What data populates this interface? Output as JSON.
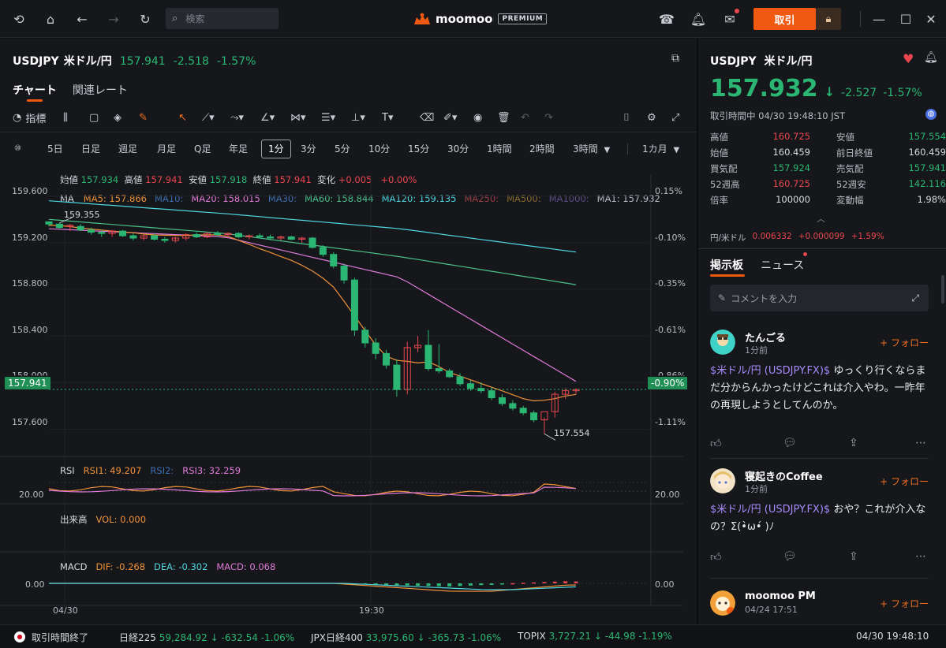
{
  "search": {
    "placeholder": "検索"
  },
  "logo": {
    "name": "moomoo",
    "badge": "PREMIUM"
  },
  "topbar": {
    "trade_label": "取引"
  },
  "instrument": {
    "code": "USDJPY",
    "name": "米ドル/円",
    "price": "157.941",
    "change": "-2.518",
    "change_pct": "-1.57%"
  },
  "left_tabs": [
    "チャート",
    "関連レート"
  ],
  "tools": {
    "indicators_label": "指標"
  },
  "intervals": [
    "5日",
    "日足",
    "週足",
    "月足",
    "Q足",
    "年足",
    "1分",
    "3分",
    "5分",
    "10分",
    "15分",
    "30分",
    "1時間",
    "2時間",
    "3時間",
    "1カ月"
  ],
  "ohlc": {
    "open_label": "始値",
    "open": "157.934",
    "high_label": "高値",
    "high": "157.941",
    "low_label": "安値",
    "low": "157.918",
    "close_label": "終値",
    "close": "157.941",
    "chg_label": "変化",
    "chg": "+0.005",
    "chg_pct": "+0.00%"
  },
  "ma_legend": {
    "label": "MA",
    "items": [
      {
        "text": "MA5: 157.866",
        "color": "#f0923a"
      },
      {
        "text": "MA10:",
        "color": "#3c6fb0"
      },
      {
        "text": "MA20: 158.015",
        "color": "#e07ad8"
      },
      {
        "text": "MA30:",
        "color": "#3c6fb0"
      },
      {
        "text": "MA60: 158.844",
        "color": "#4bc08a"
      },
      {
        "text": "MA120: 159.135",
        "color": "#4fd6e0"
      },
      {
        "text": "MA250:",
        "color": "#9c3f48"
      },
      {
        "text": "MA500:",
        "color": "#8a6a2f"
      },
      {
        "text": "MA1000:",
        "color": "#5c4f86"
      },
      {
        "text": "MA1: 157.932",
        "color": "#b9bcc2"
      }
    ]
  },
  "price_axis": [
    "159.600",
    "159.200",
    "158.800",
    "158.400",
    "158.000",
    "157.600"
  ],
  "pct_axis": [
    "0.15%",
    "-0.10%",
    "-0.35%",
    "-0.61%",
    "-0.86%",
    "-1.11%"
  ],
  "current_price_tag": "157.941",
  "current_pct_tag": "-0.90%",
  "high_marker": "159.355",
  "low_marker": "157.554",
  "rsi": {
    "label": "RSI",
    "rsi1": "RSI1: 49.207",
    "rsi2": "RSI2:",
    "rsi3": "RSI3: 32.259",
    "level": "20.00"
  },
  "volume": {
    "label": "出来高",
    "vol": "VOL: 0.000"
  },
  "macd": {
    "label": "MACD",
    "dif": "DIF: -0.268",
    "dea": "DEA: -0.302",
    "macd": "MACD: 0.068",
    "zero": "0.00"
  },
  "time_axis": [
    "04/30",
    "19:30"
  ],
  "chart_data": {
    "type": "candlestick",
    "title": "USDJPY 米ドル/円",
    "ylim": [
      157.4,
      159.7
    ],
    "candles": [
      [
        159.38,
        159.38,
        159.34,
        159.36
      ],
      [
        159.36,
        159.37,
        159.32,
        159.33
      ],
      [
        159.34,
        159.36,
        159.3,
        159.35
      ],
      [
        159.34,
        159.36,
        159.3,
        159.31
      ],
      [
        159.31,
        159.33,
        159.27,
        159.29
      ],
      [
        159.29,
        159.31,
        159.25,
        159.28
      ],
      [
        159.28,
        159.31,
        159.25,
        159.3
      ],
      [
        159.3,
        159.31,
        159.25,
        159.26
      ],
      [
        159.26,
        159.28,
        159.22,
        159.24
      ],
      [
        159.24,
        159.27,
        159.22,
        159.26
      ],
      [
        159.26,
        159.28,
        159.22,
        159.23
      ],
      [
        159.23,
        159.25,
        159.2,
        159.22
      ],
      [
        159.22,
        159.25,
        159.2,
        159.24
      ],
      [
        159.24,
        159.28,
        159.22,
        159.27
      ],
      [
        159.27,
        159.29,
        159.24,
        159.25
      ],
      [
        159.25,
        159.29,
        159.24,
        159.28
      ],
      [
        159.28,
        159.3,
        159.25,
        159.27
      ],
      [
        159.27,
        159.29,
        159.25,
        159.28
      ],
      [
        159.28,
        159.29,
        159.24,
        159.25
      ],
      [
        159.25,
        159.27,
        159.23,
        159.26
      ],
      [
        159.26,
        159.28,
        159.24,
        159.25
      ],
      [
        159.25,
        159.27,
        159.22,
        159.24
      ],
      [
        159.24,
        159.26,
        159.22,
        159.25
      ],
      [
        159.25,
        159.26,
        159.22,
        159.23
      ],
      [
        159.23,
        159.25,
        159.2,
        159.24
      ],
      [
        159.24,
        159.25,
        159.15,
        159.16
      ],
      [
        159.16,
        159.18,
        159.08,
        159.1
      ],
      [
        159.1,
        159.12,
        158.98,
        159.0
      ],
      [
        159.0,
        159.02,
        158.85,
        158.88
      ],
      [
        158.88,
        158.9,
        158.4,
        158.45
      ],
      [
        158.45,
        158.48,
        158.3,
        158.34
      ],
      [
        158.34,
        158.38,
        158.2,
        158.25
      ],
      [
        158.25,
        158.28,
        158.12,
        158.15
      ],
      [
        158.15,
        158.2,
        157.88,
        157.94
      ],
      [
        157.94,
        158.35,
        157.9,
        158.3
      ],
      [
        158.3,
        158.4,
        158.26,
        158.32
      ],
      [
        158.32,
        158.45,
        158.1,
        158.12
      ],
      [
        158.12,
        158.33,
        158.08,
        158.1
      ],
      [
        158.1,
        158.12,
        158.04,
        158.05
      ],
      [
        158.05,
        158.08,
        157.97,
        157.99
      ],
      [
        157.99,
        158.02,
        157.93,
        157.95
      ],
      [
        157.95,
        158.0,
        157.91,
        157.93
      ],
      [
        157.93,
        157.96,
        157.85,
        157.87
      ],
      [
        157.87,
        157.9,
        157.8,
        157.82
      ],
      [
        157.82,
        157.85,
        157.76,
        157.78
      ],
      [
        157.78,
        157.8,
        157.72,
        157.74
      ],
      [
        157.74,
        157.76,
        157.66,
        157.68
      ],
      [
        157.68,
        157.7,
        157.56,
        157.75
      ],
      [
        157.75,
        157.92,
        157.7,
        157.9
      ],
      [
        157.9,
        157.95,
        157.86,
        157.93
      ],
      [
        157.93,
        157.95,
        157.9,
        157.94
      ]
    ],
    "series": [
      {
        "name": "MA120",
        "values": [
          159.56,
          159.45,
          159.32,
          159.12
        ]
      },
      {
        "name": "MA60",
        "values": [
          159.4,
          159.28,
          159.08,
          158.84
        ]
      },
      {
        "name": "MA20",
        "values": [
          159.32,
          159.25,
          158.9,
          158.01
        ]
      },
      {
        "name": "MA5",
        "values": [
          159.35,
          159.26,
          158.2,
          157.87
        ]
      }
    ]
  },
  "right": {
    "code": "USDJPY",
    "name": "米ドル/円",
    "price": "157.932",
    "change": "-2.527",
    "change_pct": "-1.57%",
    "status": "取引時間中 04/30 19:48:10 JST",
    "stats": [
      {
        "k": "高値",
        "v": "160.725",
        "c": "red"
      },
      {
        "k": "安値",
        "v": "157.554",
        "c": "green"
      },
      {
        "k": "始値",
        "v": "160.459",
        "c": "plain"
      },
      {
        "k": "前日終値",
        "v": "160.459",
        "c": "plain"
      },
      {
        "k": "買気配",
        "v": "157.924",
        "c": "green"
      },
      {
        "k": "売気配",
        "v": "157.941",
        "c": "green"
      },
      {
        "k": "52週高",
        "v": "160.725",
        "c": "red"
      },
      {
        "k": "52週安",
        "v": "142.116",
        "c": "green"
      },
      {
        "k": "倍率",
        "v": "100000",
        "c": "plain"
      },
      {
        "k": "変動幅",
        "v": "1.98%",
        "c": "plain"
      }
    ],
    "fx": {
      "label": "円/米ドル",
      "value": "0.006332",
      "change": "+0.000099",
      "pct": "+1.59%"
    },
    "tabs": [
      "掲示板",
      "ニュース"
    ],
    "comment_placeholder": "コメントを入力",
    "follow_label": "+ フォロー",
    "posts": [
      {
        "name": "たんごる",
        "time": "1分前",
        "link": "$米ドル/円 (USDJPY.FX)$",
        "text": " ゆっくり行くならまだ分からんかったけどこれは介入やわ。一昨年の再現しようとしてんのか。"
      },
      {
        "name": "寝起きのCoffee",
        "time": "1分前",
        "link": "$米ドル/円 (USDJPY.FX)$",
        "text": " おや？これが介入なの？Σ(•̀ω•́ )ﾉ"
      },
      {
        "name": "moomoo PM",
        "time": "04/24 17:51",
        "link": "",
        "text": ""
      }
    ]
  },
  "statusbar": {
    "market": "取引時間終了",
    "nikkei_label": "日経225",
    "nikkei": "59,284.92",
    "nikkei_chg": "-632.54",
    "nikkei_pct": "-1.06%",
    "jpx_label": "JPX日経400",
    "jpx": "33,975.60",
    "jpx_chg": "-365.73",
    "jpx_pct": "-1.06%",
    "topix_label": "TOPIX",
    "topix": "3,727.21",
    "topix_chg": "-44.98",
    "topix_pct": "-1.19%",
    "clock": "04/30 19:48:10"
  }
}
